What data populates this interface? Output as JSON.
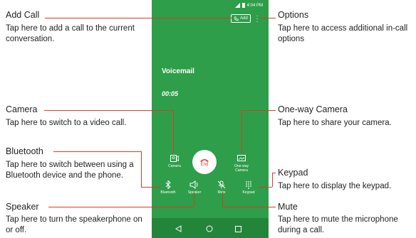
{
  "phone": {
    "status_time": "4:04 PM",
    "add_label": "Add",
    "caller": "Voicemail",
    "timer": "00:05",
    "camera_label": "Camera",
    "end_label": "End",
    "oneway_label": "One-way Camera",
    "bluetooth_label": "Bluetooth",
    "speaker_label": "Speaker",
    "mute_label": "Mute",
    "keypad_label": "Keypad"
  },
  "callouts": {
    "add_call": {
      "title": "Add Call",
      "desc": "Tap here to add a call to the current conversation."
    },
    "options": {
      "title": "Options",
      "desc": "Tap here to access additional in-call options"
    },
    "camera": {
      "title": "Camera",
      "desc": "Tap here to switch to a video call."
    },
    "bluetooth": {
      "title": "Bluetooth",
      "desc": "Tap here to switch between using a Bluetooth device and the phone."
    },
    "speaker": {
      "title": "Speaker",
      "desc": "Tap here to turn the speakerphone on or off."
    },
    "oneway": {
      "title": "One-way Camera",
      "desc": "Tap here to share your camera."
    },
    "keypad": {
      "title": "Keypad",
      "desc": "Tap here to display the keypad."
    },
    "mute": {
      "title": "Mute",
      "desc": "Tap here to mute the microphone during a call."
    }
  },
  "colors": {
    "phone_bg": "#2e9e4a",
    "callout_line": "#d93a2b",
    "end_button": "#e03a2a"
  }
}
